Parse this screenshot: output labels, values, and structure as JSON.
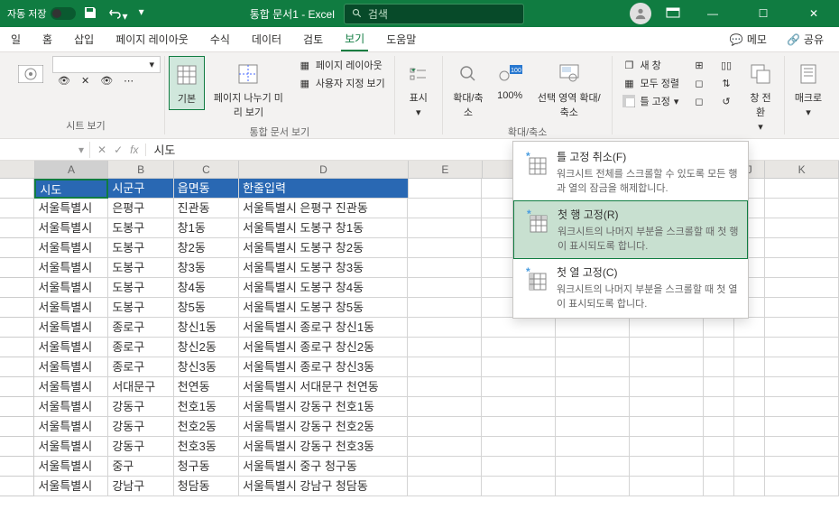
{
  "titlebar": {
    "autosave_label": "자동 저장",
    "doc_title": "통합 문서1 - Excel",
    "search_placeholder": "검색"
  },
  "tabs": {
    "items": [
      "일",
      "홈",
      "삽입",
      "페이지 레이아웃",
      "수식",
      "데이터",
      "검토",
      "보기",
      "도움말"
    ],
    "active_index": 7,
    "memo_btn": "메모",
    "share_btn": "공유"
  },
  "ribbon": {
    "group1_label": "시트 보기",
    "normal_view": "기본",
    "page_break": "페이지 나누기 미리 보기",
    "page_layout": "페이지 레이아웃",
    "custom_view": "사용자 지정 보기",
    "group2_label": "통합 문서 보기",
    "display": "표시",
    "group3_label": "확대/축소",
    "zoom": "확대/축소",
    "zoom100": "100%",
    "zoom_selection": "선택 영역 확대/축소",
    "new_window": "새 창",
    "arrange_all": "모두 정렬",
    "freeze_panes": "틀 고정",
    "switch_windows": "창 전환",
    "macros": "매크로"
  },
  "formula_bar": {
    "name_box": "",
    "formula": "시도"
  },
  "dropdown": {
    "item1_title": "틀 고정 취소(F)",
    "item1_desc": "워크시트 전체를 스크롤할 수 있도록 모든 행과 열의 잠금을 해제합니다.",
    "item2_title": "첫 행 고정(R)",
    "item2_desc": "워크시트의 나머지 부분을 스크롤할 때 첫 행이 표시되도록 합니다.",
    "item3_title": "첫 열 고정(C)",
    "item3_desc": "워크시트의 나머지 부분을 스크롤할 때 첫 열이 표시되도록 합니다."
  },
  "grid": {
    "columns": [
      "A",
      "B",
      "C",
      "D",
      "E",
      "F",
      "G",
      "H",
      "I",
      "J",
      "K"
    ],
    "headers": [
      "시도",
      "시군구",
      "읍면동",
      "한줄입력"
    ],
    "rows": [
      [
        "서울특별시",
        "은평구",
        "진관동",
        "서울특별시 은평구 진관동"
      ],
      [
        "서울특별시",
        "도봉구",
        "창1동",
        "서울특별시 도봉구 창1동"
      ],
      [
        "서울특별시",
        "도봉구",
        "창2동",
        "서울특별시 도봉구 창2동"
      ],
      [
        "서울특별시",
        "도봉구",
        "창3동",
        "서울특별시 도봉구 창3동"
      ],
      [
        "서울특별시",
        "도봉구",
        "창4동",
        "서울특별시 도봉구 창4동"
      ],
      [
        "서울특별시",
        "도봉구",
        "창5동",
        "서울특별시 도봉구 창5동"
      ],
      [
        "서울특별시",
        "종로구",
        "창신1동",
        "서울특별시 종로구 창신1동"
      ],
      [
        "서울특별시",
        "종로구",
        "창신2동",
        "서울특별시 종로구 창신2동"
      ],
      [
        "서울특별시",
        "종로구",
        "창신3동",
        "서울특별시 종로구 창신3동"
      ],
      [
        "서울특별시",
        "서대문구",
        "천연동",
        "서울특별시 서대문구 천연동"
      ],
      [
        "서울특별시",
        "강동구",
        "천호1동",
        "서울특별시 강동구 천호1동"
      ],
      [
        "서울특별시",
        "강동구",
        "천호2동",
        "서울특별시 강동구 천호2동"
      ],
      [
        "서울특별시",
        "강동구",
        "천호3동",
        "서울특별시 강동구 천호3동"
      ],
      [
        "서울특별시",
        "중구",
        "청구동",
        "서울특별시 중구 청구동"
      ],
      [
        "서울특별시",
        "강남구",
        "청담동",
        "서울특별시 강남구 청담동"
      ]
    ]
  }
}
